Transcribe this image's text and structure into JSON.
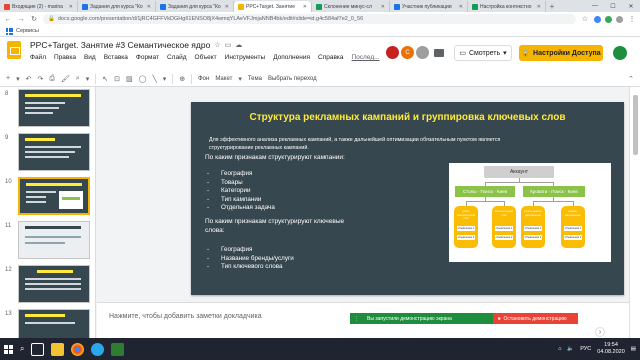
{
  "browser": {
    "tabs": [
      {
        "label": "Входящие (2) - marina",
        "favicon_color": "#ea4335",
        "active": false
      },
      {
        "label": "Задания для курса \"Ко",
        "favicon_color": "#1a73e8",
        "active": false
      },
      {
        "label": "Задания для курса \"Ко",
        "favicon_color": "#1a73e8",
        "active": false
      },
      {
        "label": "PPC+Target. Занятие",
        "favicon_color": "#f4b400",
        "active": true
      },
      {
        "label": "Склонение минус-сл",
        "favicon_color": "#0f9d58",
        "active": false
      },
      {
        "label": "Участник публикации",
        "favicon_color": "#1a73e8",
        "active": false
      },
      {
        "label": "Настройка контекстно",
        "favicon_color": "#0f9d58",
        "active": false
      }
    ],
    "url": "docs.google.com/presentation/d/1jRC4GFFVkDGHg61ENSO8jX4wmqYLAeVFJmjaNNB4bk/edit#slide=id.g4c584af7e2_0_56",
    "bookmark_label": "Сервисы"
  },
  "app": {
    "title": "PPC+Target. Занятие #3 Семантическое ядро",
    "menu": [
      "Файл",
      "Правка",
      "Вид",
      "Вставка",
      "Формат",
      "Слайд",
      "Объект",
      "Инструменты",
      "Дополнения",
      "Справка"
    ],
    "last_edit": "Послед...",
    "present_label": "Смотреть",
    "share_label": "Настройки Доступа",
    "avatars": [
      {
        "letter": "",
        "color": "#c5221f"
      },
      {
        "letter": "C",
        "color": "#e8710a"
      },
      {
        "letter": "",
        "color": "#9e9e9e"
      }
    ]
  },
  "toolbar": {
    "background_label": "Фон",
    "layout_label": "Макет",
    "theme_label": "Тема",
    "transition_label": "Выбрать переход"
  },
  "filmstrip": {
    "slides": [
      {
        "number": "8",
        "selected": false
      },
      {
        "number": "9",
        "selected": false
      },
      {
        "number": "10",
        "selected": true
      },
      {
        "number": "11",
        "selected": false
      },
      {
        "number": "12",
        "selected": false
      },
      {
        "number": "13",
        "selected": false
      }
    ]
  },
  "slide": {
    "title": "Структура рекламных кампаний и группировка ключевых слов",
    "intro": "Для эффективного анализа рекламных кампаний, а также дальнейшей оптимизации обязательным пунктом является структурирование рекламных кампаний.",
    "question1": "По каким признакам структурируют кампании:",
    "list1": [
      "География",
      "Товары",
      "Категории",
      "Тип кампании",
      "Отдельная задача"
    ],
    "question2a": "По каким признакам структурируют ключевые",
    "question2b": "слова:",
    "list2": [
      "География",
      "Название бренды/услуги",
      "Тип ключевого слова"
    ],
    "diagram": {
      "account": "Аккаунт",
      "campaign1": "Столы · Поиск · Киев",
      "campaign2": "Кровати · Поиск · Киев",
      "groups": [
        {
          "title": "купить компьютерный стол"
        },
        {
          "title": "компьютерный стол"
        },
        {
          "title": "купить кровать двуспальную"
        },
        {
          "title": "кровать двуспальная"
        }
      ],
      "ad1": "объявление 1",
      "ad2": "объявление 2",
      "line_color": "#9e9e9e",
      "campaign_color": "#8bc34a",
      "group_color": "#fbbc04"
    }
  },
  "notes": {
    "placeholder": "Нажмите, чтобы добавить заметки докладчика"
  },
  "presenter_bar": {
    "sharing_text": "Вы запустили демонстрацию экрана",
    "stop_label": "Остановить демонстрацию"
  },
  "taskbar": {
    "language": "РУС",
    "time": "19:54",
    "date": "04.08.2020"
  }
}
